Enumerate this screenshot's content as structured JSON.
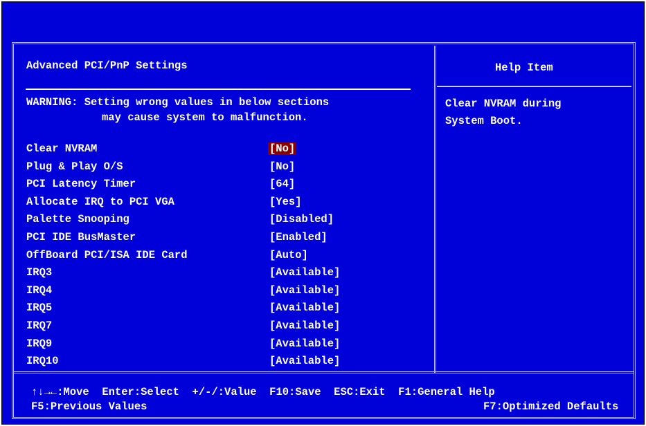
{
  "page": {
    "title": "Advanced PCI/PnP Settings",
    "warning_line1": "WARNING: Setting wrong values in below sections",
    "warning_line2": "may cause system to malfunction."
  },
  "help": {
    "title": "Help Item",
    "line1": "Clear NVRAM during",
    "line2": "System Boot."
  },
  "settings": [
    {
      "label": "Clear NVRAM",
      "value": "[No]",
      "selected": true
    },
    {
      "label": "Plug & Play O/S",
      "value": "[No]",
      "selected": false
    },
    {
      "label": "PCI Latency Timer",
      "value": "[64]",
      "selected": false
    },
    {
      "label": "Allocate IRQ to PCI VGA",
      "value": "[Yes]",
      "selected": false
    },
    {
      "label": "Palette Snooping",
      "value": "[Disabled]",
      "selected": false
    },
    {
      "label": "PCI IDE BusMaster",
      "value": "[Enabled]",
      "selected": false
    },
    {
      "label": "OffBoard PCI/ISA IDE Card",
      "value": "[Auto]",
      "selected": false
    },
    {
      "label": "IRQ3",
      "value": "[Available]",
      "selected": false
    },
    {
      "label": "IRQ4",
      "value": "[Available]",
      "selected": false
    },
    {
      "label": "IRQ5",
      "value": "[Available]",
      "selected": false
    },
    {
      "label": "IRQ7",
      "value": "[Available]",
      "selected": false
    },
    {
      "label": "IRQ9",
      "value": "[Available]",
      "selected": false
    },
    {
      "label": "IRQ10",
      "value": "[Available]",
      "selected": false
    }
  ],
  "footer": {
    "line1": "↑↓→←:Move  Enter:Select  +/-/:Value  F10:Save  ESC:Exit  F1:General Help",
    "previous_values": "F5:Previous Values",
    "optimized_defaults": "F7:Optimized Defaults"
  },
  "colors": {
    "background": "#0000d8",
    "text": "#ffffff",
    "selected_bg": "#8a0000",
    "border": "#c8c8ff"
  }
}
